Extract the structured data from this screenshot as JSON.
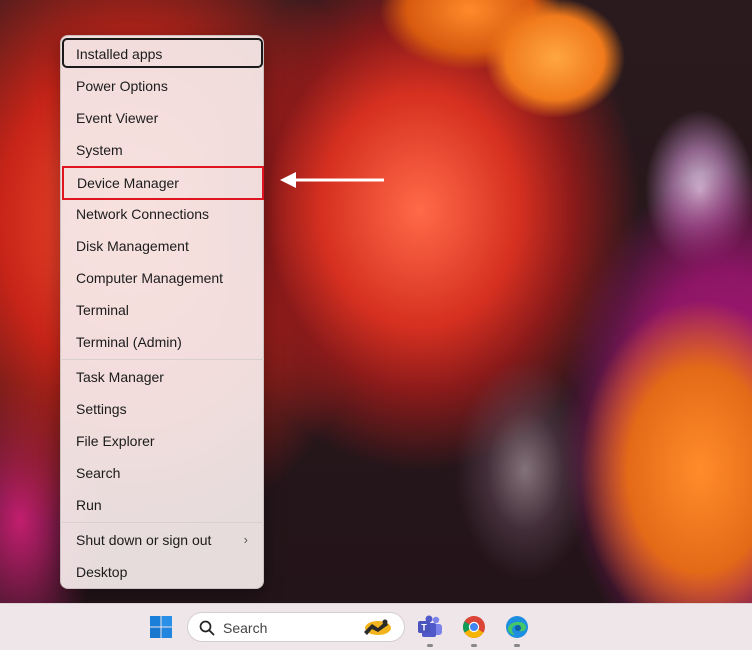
{
  "menu": {
    "items": [
      {
        "label": "Installed apps",
        "name": "menu-item-installed-apps"
      },
      {
        "label": "Power Options",
        "name": "menu-item-power-options"
      },
      {
        "label": "Event Viewer",
        "name": "menu-item-event-viewer"
      },
      {
        "label": "System",
        "name": "menu-item-system"
      },
      {
        "label": "Device Manager",
        "name": "menu-item-device-manager"
      },
      {
        "label": "Network Connections",
        "name": "menu-item-network-connections"
      },
      {
        "label": "Disk Management",
        "name": "menu-item-disk-management"
      },
      {
        "label": "Computer Management",
        "name": "menu-item-computer-management"
      },
      {
        "label": "Terminal",
        "name": "menu-item-terminal"
      },
      {
        "label": "Terminal (Admin)",
        "name": "menu-item-terminal-admin"
      },
      {
        "label": "Task Manager",
        "name": "menu-item-task-manager"
      },
      {
        "label": "Settings",
        "name": "menu-item-settings"
      },
      {
        "label": "File Explorer",
        "name": "menu-item-file-explorer"
      },
      {
        "label": "Search",
        "name": "menu-item-search"
      },
      {
        "label": "Run",
        "name": "menu-item-run"
      },
      {
        "label": "Shut down or sign out",
        "name": "menu-item-shut-down",
        "submenu": true
      },
      {
        "label": "Desktop",
        "name": "menu-item-desktop"
      }
    ],
    "focused_item": "Installed apps",
    "highlighted_item": "Device Manager"
  },
  "taskbar": {
    "search_placeholder": "Search",
    "icons": [
      "windows-start-icon",
      "search-icon",
      "search-highlight-icon",
      "teams-icon",
      "chrome-icon",
      "edge-icon"
    ]
  },
  "colors": {
    "highlight_border": "#e0141e",
    "arrow": "#ffffff",
    "taskbar": "#efe6ea"
  }
}
